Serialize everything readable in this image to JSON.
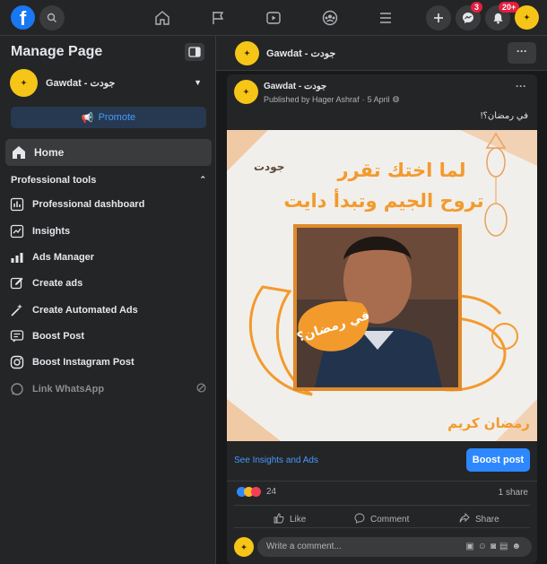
{
  "topbar": {
    "logo": "f",
    "notifications_badge": "3",
    "notifications2_badge": "20+",
    "icons": [
      "search-icon",
      "home-icon",
      "flag-icon",
      "watch-icon",
      "groups-icon",
      "menu-icon",
      "plus-icon",
      "messenger-icon",
      "bell-icon"
    ]
  },
  "sidebar": {
    "title": "Manage Page",
    "page_name": "Gawdat - جودت",
    "promote_label": "Promote",
    "home_label": "Home",
    "prof_tools_label": "Professional tools",
    "items": [
      {
        "label": "Professional dashboard",
        "icon": "dashboard-icon"
      },
      {
        "label": "Insights",
        "icon": "insights-icon"
      },
      {
        "label": "Ads Manager",
        "icon": "ads-manager-icon"
      },
      {
        "label": "Create ads",
        "icon": "edit-icon"
      },
      {
        "label": "Create Automated Ads",
        "icon": "magic-wand-icon"
      },
      {
        "label": "Boost Post",
        "icon": "boost-icon"
      },
      {
        "label": "Boost Instagram Post",
        "icon": "instagram-icon"
      },
      {
        "label": "Link WhatsApp",
        "icon": "whatsapp-icon"
      }
    ]
  },
  "page_header": {
    "name": "Gawdat - جودت",
    "more": "···"
  },
  "post": {
    "author": "Gawdat - جودت",
    "published_by": "Published by Hager Ashraf",
    "date": "5 April",
    "caption": "في رمضان؟!",
    "image": {
      "brand": "جودت",
      "headline_line1": "لما اختك تقرر",
      "headline_line2": "تروح الجيم وتبدأ دايت",
      "bubble": "في رمضان؟",
      "footer_logo": "رمضان كريم"
    },
    "see_insights": "See Insights and Ads",
    "boost_button": "Boost post",
    "reactions_count": "24",
    "shares": "1 share",
    "like": "Like",
    "comment": "Comment",
    "share": "Share",
    "comment_placeholder": "Write a comment..."
  },
  "colors": {
    "accent": "#1877f2",
    "link": "#4599ff",
    "background": "#18191a",
    "card": "#242526"
  }
}
